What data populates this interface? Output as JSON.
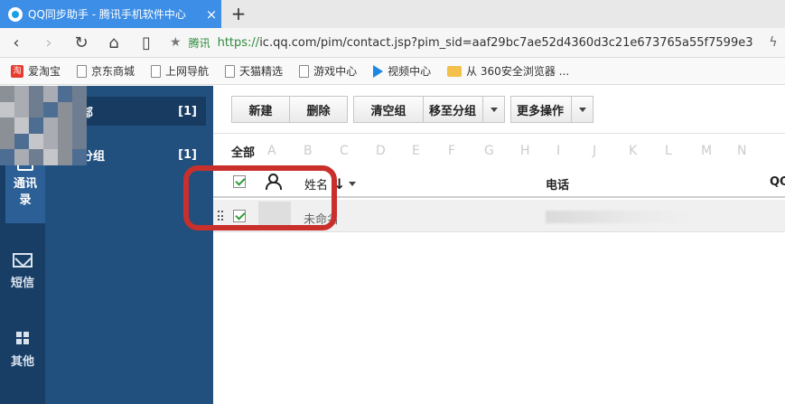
{
  "browser": {
    "tab_title": "QQ同步助手 - 腾讯手机软件中心",
    "tab_close": "×",
    "new_tab": "+",
    "nav": {
      "back": "‹",
      "forward": "›",
      "reload": "↻",
      "home": "⌂",
      "reader": "▯"
    },
    "address": {
      "star": "★",
      "secure_label": "腾讯",
      "scheme": "https://",
      "url_rest": "ic.qq.com/pim/contact.jsp?pim_sid=aaf29bc7ae52d4360d3c21e673765a55f7599e3"
    },
    "bolt": "ϟ",
    "bookmarks": [
      {
        "label": "爱淘宝",
        "icon": "taobao-icon",
        "glyph": "淘"
      },
      {
        "label": "京东商城",
        "icon": "page-icon"
      },
      {
        "label": "上网导航",
        "icon": "page-icon"
      },
      {
        "label": "天猫精选",
        "icon": "page-icon"
      },
      {
        "label": "游戏中心",
        "icon": "page-icon"
      },
      {
        "label": "视频中心",
        "icon": "video-icon"
      },
      {
        "label": "从 360安全浏览器 ...",
        "icon": "folder-icon"
      }
    ]
  },
  "rail": {
    "contacts": {
      "label_line1": "通讯",
      "label_line2": "录"
    },
    "sms": {
      "label": "短信"
    },
    "other": {
      "label": "其他"
    }
  },
  "groups": [
    {
      "name": "部",
      "count": "[1]"
    },
    {
      "name": "分组",
      "count": "[1]"
    }
  ],
  "toolbar": {
    "new": "新建",
    "delete": "删除",
    "clear_group": "清空组",
    "move_to_group": "移至分组",
    "more_actions": "更多操作"
  },
  "letters": {
    "all": "全部",
    "items": [
      "A",
      "B",
      "C",
      "D",
      "E",
      "F",
      "G",
      "H",
      "I",
      "J",
      "K",
      "L",
      "M",
      "N"
    ]
  },
  "table": {
    "headers": {
      "name": "姓名",
      "sort": "↓",
      "phone": "电话",
      "qq": "QQ"
    },
    "rows": [
      {
        "name": "未命名"
      }
    ]
  },
  "colors": {
    "tab_blue": "#3c8ee6",
    "rail_bg": "#193e66",
    "groups_bg": "#214f7e",
    "highlight_red": "#c9302c",
    "check_green": "#2e9d3a"
  }
}
